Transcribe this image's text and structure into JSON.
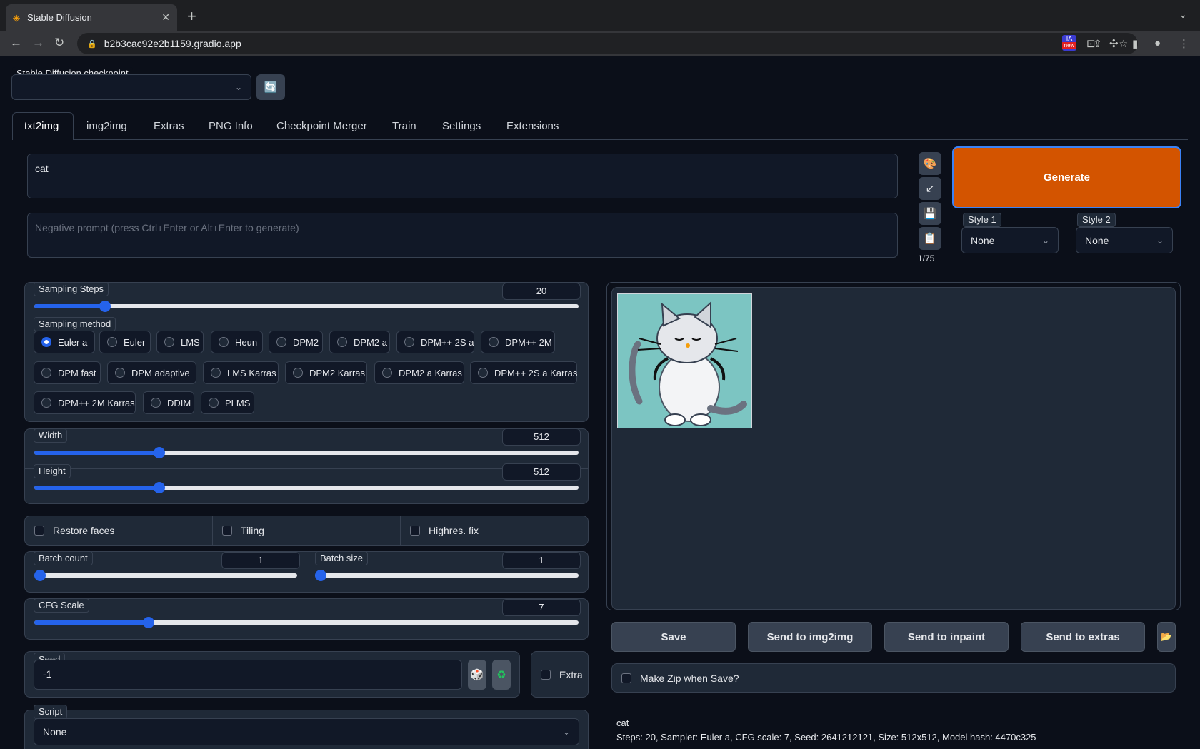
{
  "browser": {
    "tab_title": "Stable Diffusion",
    "url": "b2b3cac92e2b1159.gradio.app",
    "ext_badge": "new"
  },
  "checkpoint": {
    "label": "Stable Diffusion checkpoint",
    "value": ""
  },
  "tabs": [
    "txt2img",
    "img2img",
    "Extras",
    "PNG Info",
    "Checkpoint Merger",
    "Train",
    "Settings",
    "Extensions"
  ],
  "prompt": {
    "value": "cat",
    "negative_placeholder": "Negative prompt (press Ctrl+Enter or Alt+Enter to generate)",
    "token_count": "1/75"
  },
  "generate_label": "Generate",
  "styles": [
    {
      "label": "Style 1",
      "value": "None"
    },
    {
      "label": "Style 2",
      "value": "None"
    }
  ],
  "sampling_steps": {
    "label": "Sampling Steps",
    "value": "20",
    "fraction": 0.13
  },
  "sampling_method": {
    "label": "Sampling method",
    "selected": "Euler a",
    "options": [
      "Euler a",
      "Euler",
      "LMS",
      "Heun",
      "DPM2",
      "DPM2 a",
      "DPM++ 2S a",
      "DPM++ 2M",
      "DPM fast",
      "DPM adaptive",
      "LMS Karras",
      "DPM2 Karras",
      "DPM2 a Karras",
      "DPM++ 2S a Karras",
      "DPM++ 2M Karras",
      "DDIM",
      "PLMS"
    ]
  },
  "width": {
    "label": "Width",
    "value": "512",
    "fraction": 0.23
  },
  "height": {
    "label": "Height",
    "value": "512",
    "fraction": 0.23
  },
  "checkboxes": {
    "restore_faces": "Restore faces",
    "tiling": "Tiling",
    "highres": "Highres. fix"
  },
  "batch_count": {
    "label": "Batch count",
    "value": "1",
    "fraction": 0
  },
  "batch_size": {
    "label": "Batch size",
    "value": "1",
    "fraction": 0
  },
  "cfg_scale": {
    "label": "CFG Scale",
    "value": "7",
    "fraction": 0.21
  },
  "seed": {
    "label": "Seed",
    "value": "-1",
    "extra_label": "Extra"
  },
  "script": {
    "label": "Script",
    "value": "None"
  },
  "output": {
    "buttons": [
      "Save",
      "Send to img2img",
      "Send to inpaint",
      "Send to extras"
    ],
    "zip_label": "Make Zip when Save?",
    "info_line1": "cat",
    "info_line2": "Steps: 20, Sampler: Euler a, CFG scale: 7, Seed: 2641212121, Size: 512x512, Model hash: 4470c325"
  },
  "colors": {
    "accent": "#2563eb",
    "generate": "#d35400",
    "bg": "#0b0f19",
    "panel": "#1f2937"
  }
}
